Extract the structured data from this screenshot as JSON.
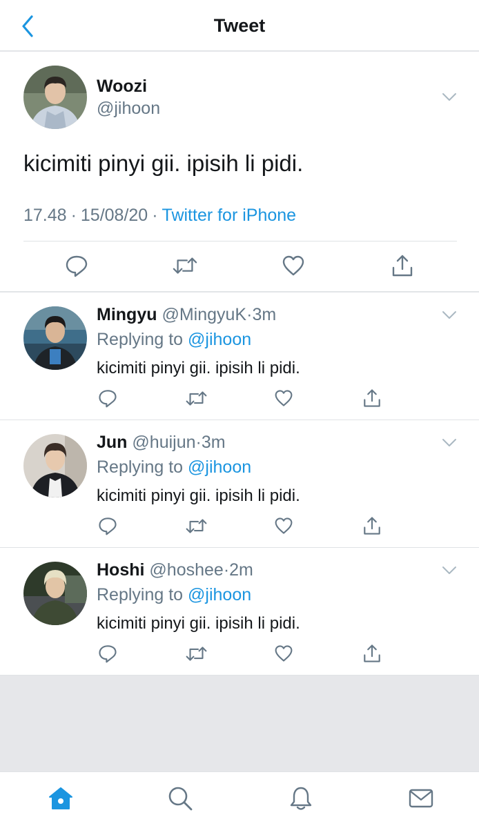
{
  "header": {
    "title": "Tweet",
    "back_icon": "chevron-left-icon"
  },
  "colors": {
    "accent": "#1b95e0",
    "secondary_text": "#657786",
    "primary_text": "#14171a",
    "divider": "#dfe2e5",
    "background": "#e6e7ea"
  },
  "main_tweet": {
    "name": "Woozi",
    "handle": "@jihoon",
    "text": "kicimiti pinyi gii. ipisih li pidi.",
    "time": "17.48",
    "separator": "·",
    "date": "15/08/20",
    "source": "Twitter for iPhone"
  },
  "replies": [
    {
      "name": "Mingyu",
      "handle": "@MingyuK",
      "separator": "·",
      "time": "3m",
      "replying_label": "Replying to",
      "replying_to": "@jihoon",
      "text": "kicimiti pinyi gii. ipisih li pidi."
    },
    {
      "name": "Jun",
      "handle": "@huijun",
      "separator": "·",
      "time": "3m",
      "replying_label": "Replying to",
      "replying_to": "@jihoon",
      "text": "kicimiti pinyi gii. ipisih li pidi."
    },
    {
      "name": "Hoshi",
      "handle": "@hoshee",
      "separator": "·",
      "time": "2m",
      "replying_label": "Replying to",
      "replying_to": "@jihoon",
      "text": "kicimiti pinyi gii. ipisih li pidi."
    }
  ],
  "actions": [
    "reply-icon",
    "retweet-icon",
    "like-icon",
    "share-icon"
  ],
  "tabbar": {
    "tabs": [
      "home-icon",
      "search-icon",
      "notifications-icon",
      "messages-icon"
    ],
    "active": "home-icon"
  }
}
